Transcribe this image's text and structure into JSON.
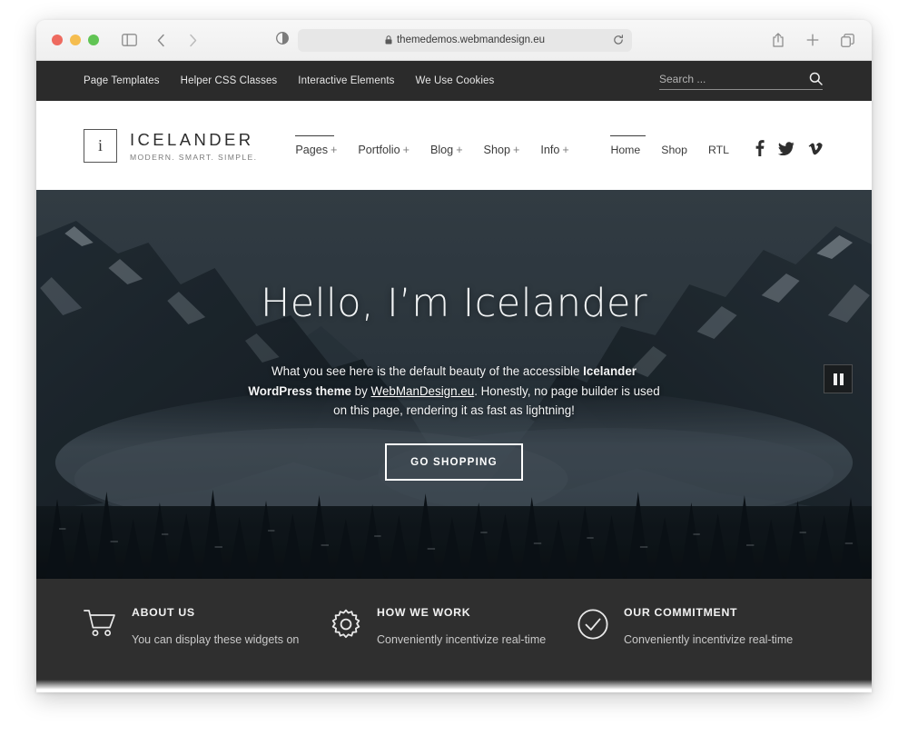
{
  "browser": {
    "url": "themedemos.webmandesign.eu",
    "icons": {
      "sidebar": "sidebar-icon",
      "back": "back-arrow-icon",
      "forward": "forward-arrow-icon",
      "reader": "reader-mode-icon",
      "lock": "lock-icon",
      "reload": "reload-icon",
      "share": "share-icon",
      "new_tab": "plus-icon",
      "tabs": "tab-overview-icon"
    },
    "traffic_lights": {
      "close": "#ee6a5f",
      "minimize": "#f5bd4f",
      "maximize": "#61c454"
    }
  },
  "top_bar": {
    "nav": [
      {
        "label": "Page Templates"
      },
      {
        "label": "Helper CSS Classes"
      },
      {
        "label": "Interactive Elements"
      },
      {
        "label": "We Use Cookies"
      }
    ],
    "search": {
      "placeholder": "Search ...",
      "value": "",
      "icon": "search-icon"
    },
    "background": "#2b2b2b"
  },
  "header": {
    "logo_letter": "i",
    "site_title": "ICELANDER",
    "tagline": "MODERN. SMART. SIMPLE.",
    "primary_menu": [
      {
        "label": "Pages",
        "submenu": "+",
        "active": true
      },
      {
        "label": "Portfolio",
        "submenu": "+",
        "active": false
      },
      {
        "label": "Blog",
        "submenu": "+",
        "active": false
      },
      {
        "label": "Shop",
        "submenu": "+",
        "active": false
      },
      {
        "label": "Info",
        "submenu": "+",
        "active": false
      }
    ],
    "secondary_menu": [
      {
        "label": "Home",
        "active": true
      },
      {
        "label": "Shop",
        "active": false
      },
      {
        "label": "RTL",
        "active": false
      }
    ],
    "social": [
      {
        "name": "facebook-icon"
      },
      {
        "name": "twitter-icon"
      },
      {
        "name": "vimeo-icon"
      }
    ]
  },
  "hero": {
    "title": "Hello, I’m Icelander",
    "text_part1": "What you see here is the default beauty of the accessible ",
    "text_bold1": "Icelander WordPress theme",
    "text_part2": " by ",
    "text_link": "WebManDesign.eu",
    "text_part3": ". Honestly, no page builder is used on this page, rendering it as fast as lightning!",
    "button_label": "GO SHOPPING",
    "pause_button": "pause-icon",
    "image_description": "snowy mountain valley with mist and dark pine forest"
  },
  "widgets": [
    {
      "icon": "shopping-cart-icon",
      "title": "ABOUT US",
      "text": "You can display these widgets on"
    },
    {
      "icon": "gear-icon",
      "title": "HOW WE WORK",
      "text": "Conveniently incentivize real-time"
    },
    {
      "icon": "check-circle-icon",
      "title": "OUR COMMITMENT",
      "text": "Conveniently incentivize real-time"
    }
  ]
}
